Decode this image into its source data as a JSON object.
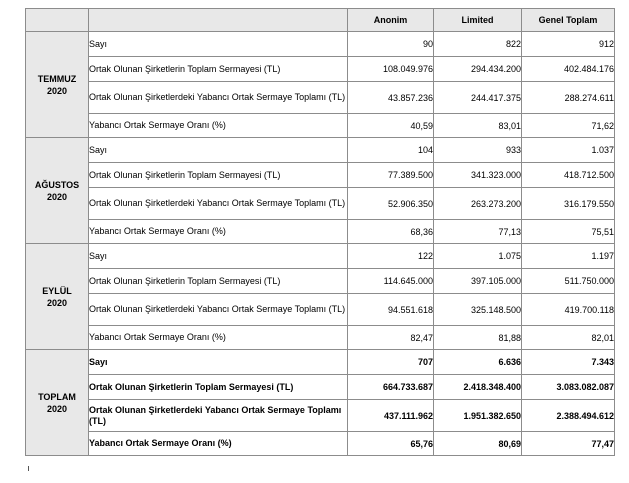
{
  "table": {
    "headers": {
      "anonim": "Anonim",
      "limited": "Limited",
      "genel_toplam": "Genel Toplam"
    },
    "labels": {
      "sayi": "Sayı",
      "toplam_sermaye": "Ortak Olunan Şirketlerin Toplam Sermayesi (TL)",
      "yabanci_sermaye": "Ortak Olunan Şirketlerdeki Yabancı Ortak Sermaye Toplamı (TL)",
      "oran": "Yabancı Ortak Sermaye Oranı (%)"
    },
    "groups": [
      {
        "month": "TEMMUZ",
        "year": "2020",
        "rows": [
          {
            "label": "Sayı",
            "anonim": "90",
            "limited": "822",
            "toplam": "912"
          },
          {
            "label": "Ortak Olunan Şirketlerin Toplam Sermayesi (TL)",
            "anonim": "108.049.976",
            "limited": "294.434.200",
            "toplam": "402.484.176"
          },
          {
            "label": "Ortak Olunan Şirketlerdeki Yabancı Ortak Sermaye Toplamı (TL)",
            "anonim": "43.857.236",
            "limited": "244.417.375",
            "toplam": "288.274.611"
          },
          {
            "label": "Yabancı Ortak Sermaye Oranı (%)",
            "anonim": "40,59",
            "limited": "83,01",
            "toplam": "71,62"
          }
        ]
      },
      {
        "month": "AĞUSTOS",
        "year": "2020",
        "rows": [
          {
            "label": "Sayı",
            "anonim": "104",
            "limited": "933",
            "toplam": "1.037"
          },
          {
            "label": "Ortak Olunan Şirketlerin Toplam Sermayesi  (TL)",
            "anonim": "77.389.500",
            "limited": "341.323.000",
            "toplam": "418.712.500"
          },
          {
            "label": "Ortak Olunan Şirketlerdeki Yabancı Ortak Sermaye Toplamı  (TL)",
            "anonim": "52.906.350",
            "limited": "263.273.200",
            "toplam": "316.179.550"
          },
          {
            "label": "Yabancı Ortak Sermaye Oranı (%)",
            "anonim": "68,36",
            "limited": "77,13",
            "toplam": "75,51"
          }
        ]
      },
      {
        "month": "EYLÜL",
        "year": "2020",
        "rows": [
          {
            "label": "Sayı",
            "anonim": "122",
            "limited": "1.075",
            "toplam": "1.197"
          },
          {
            "label": "Ortak Olunan Şirketlerin Toplam Sermayesi  (TL)",
            "anonim": "114.645.000",
            "limited": "397.105.000",
            "toplam": "511.750.000"
          },
          {
            "label": "Ortak Olunan Şirketlerdeki Yabancı Ortak Sermaye Toplamı  (TL)",
            "anonim": "94.551.618",
            "limited": "325.148.500",
            "toplam": "419.700.118"
          },
          {
            "label": "Yabancı Ortak Sermaye Oranı (%)",
            "anonim": "82,47",
            "limited": "81,88",
            "toplam": "82,01"
          }
        ]
      },
      {
        "month": "TOPLAM",
        "year": "2020",
        "rows": [
          {
            "label": "Sayı",
            "anonim": "707",
            "limited": "6.636",
            "toplam": "7.343"
          },
          {
            "label": "Ortak Olunan Şirketlerin Toplam Sermayesi  (TL)",
            "anonim": "664.733.687",
            "limited": "2.418.348.400",
            "toplam": "3.083.082.087"
          },
          {
            "label": "Ortak Olunan Şirketlerdeki Yabancı Ortak Sermaye Toplamı  (TL)",
            "anonim": "437.111.962",
            "limited": "1.951.382.650",
            "toplam": "2.388.494.612"
          },
          {
            "label": "Yabancı Ortak Sermaye Oranı (%)",
            "anonim": "65,76",
            "limited": "80,69",
            "toplam": "77,47"
          }
        ]
      }
    ]
  }
}
